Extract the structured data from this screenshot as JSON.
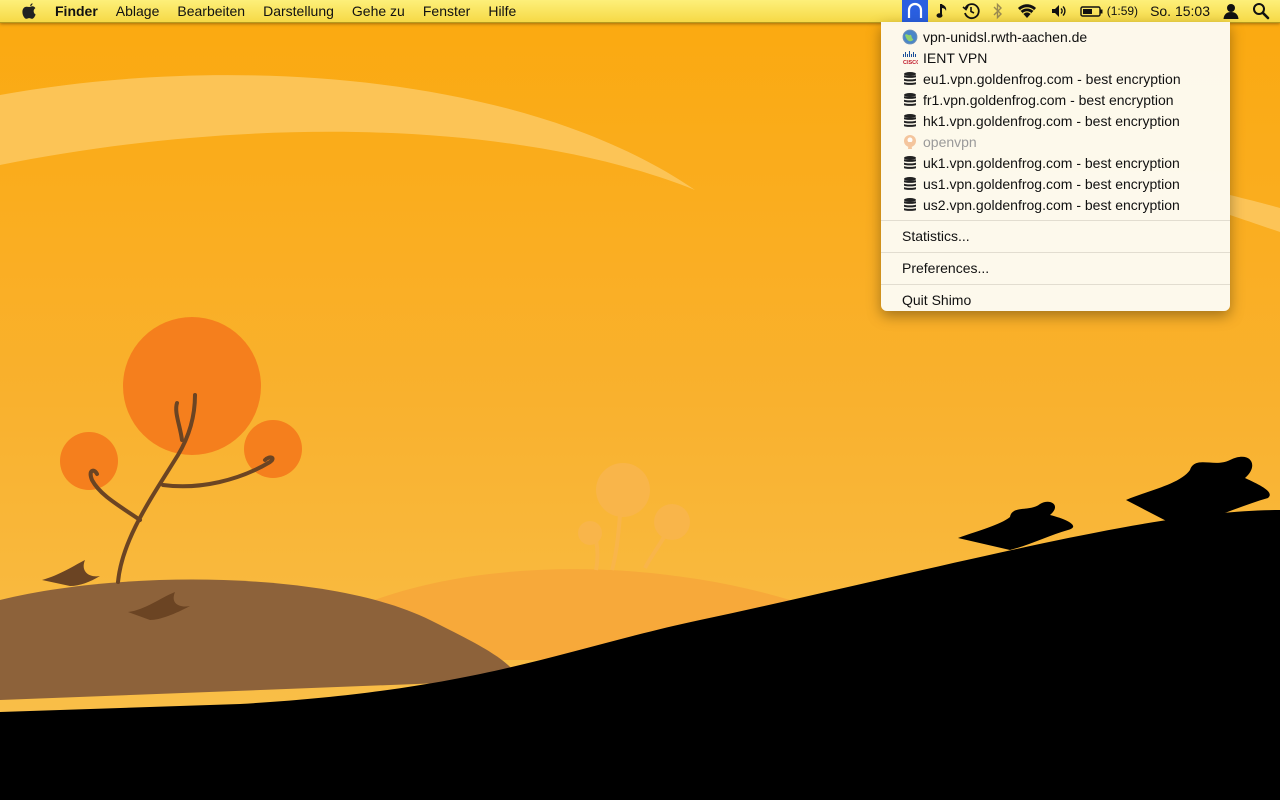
{
  "menubar": {
    "app_name": "Finder",
    "menus": [
      "Ablage",
      "Bearbeiten",
      "Darstellung",
      "Gehe zu",
      "Fenster",
      "Hilfe"
    ],
    "battery_time": "(1:59)",
    "clock": "So. 15:03",
    "status_icons": [
      "shimo-vpn-icon",
      "music-note-icon",
      "time-machine-icon",
      "bluetooth-icon",
      "wifi-icon",
      "volume-icon",
      "battery-icon",
      "user-icon",
      "spotlight-icon"
    ]
  },
  "vpn_menu": {
    "connections": [
      {
        "label": "vpn-unidsl.rwth-aachen.de",
        "icon": "globe-icon",
        "enabled": true
      },
      {
        "label": "IENT VPN",
        "icon": "cisco-icon",
        "enabled": true
      },
      {
        "label": "eu1.vpn.goldenfrog.com - best encryption",
        "icon": "server-stack-icon",
        "enabled": true
      },
      {
        "label": "fr1.vpn.goldenfrog.com - best encryption",
        "icon": "server-stack-icon",
        "enabled": true
      },
      {
        "label": "hk1.vpn.goldenfrog.com - best encryption",
        "icon": "server-stack-icon",
        "enabled": true
      },
      {
        "label": "openvpn",
        "icon": "openvpn-icon",
        "enabled": false
      },
      {
        "label": "uk1.vpn.goldenfrog.com - best encryption",
        "icon": "server-stack-icon",
        "enabled": true
      },
      {
        "label": "us1.vpn.goldenfrog.com - best encryption",
        "icon": "server-stack-icon",
        "enabled": true
      },
      {
        "label": "us2.vpn.goldenfrog.com - best encryption",
        "icon": "server-stack-icon",
        "enabled": true
      }
    ],
    "statistics_label": "Statistics...",
    "preferences_label": "Preferences...",
    "quit_label": "Quit Shimo"
  },
  "colors": {
    "sky": "#f9a51a",
    "menubar": "#f8e15a",
    "hill_brown": "#8b6137",
    "tree_orange": "#f57f20",
    "silhouette": "#000000",
    "active_highlight": "#2a5fe0"
  }
}
